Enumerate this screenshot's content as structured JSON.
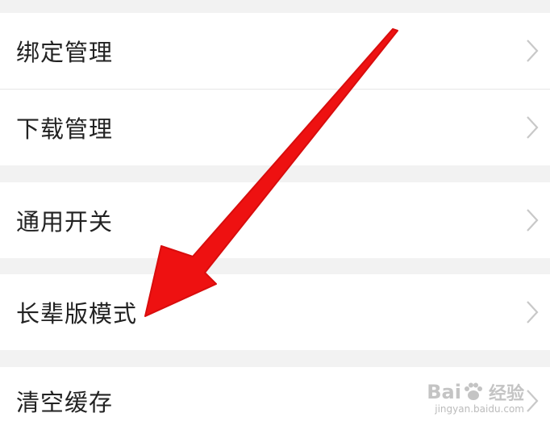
{
  "settings": {
    "items": [
      {
        "label": "绑定管理",
        "icon": "chevron-right-icon"
      },
      {
        "label": "下载管理",
        "icon": "chevron-right-icon"
      },
      {
        "label": "通用开关",
        "icon": "chevron-right-icon"
      },
      {
        "label": "长辈版模式",
        "icon": "chevron-right-icon"
      },
      {
        "label": "清空缓存",
        "icon": "chevron-right-icon"
      }
    ]
  },
  "watermark": {
    "brand_left": "Bai",
    "brand_right": "经验",
    "url": "jingyan.baidu.com"
  },
  "colors": {
    "background": "#f2f2f2",
    "row": "#ffffff",
    "text": "#222222",
    "chevron": "#c8c8c8",
    "arrow": "#ee1111"
  }
}
